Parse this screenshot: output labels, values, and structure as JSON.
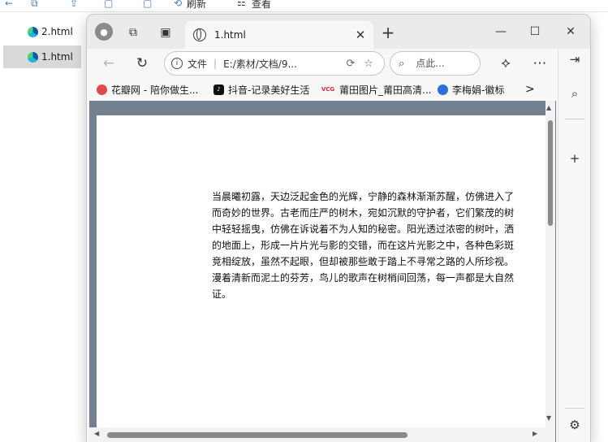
{
  "explorer": {
    "ribbon_items": [
      "刷新",
      "查看"
    ],
    "files": [
      {
        "name": "2.html",
        "selected": false
      },
      {
        "name": "1.html",
        "selected": true
      }
    ]
  },
  "browser": {
    "tab": {
      "title": "1.html"
    },
    "address": {
      "label": "文件",
      "url": "E:/素材/文档/9..."
    },
    "search": {
      "placeholder": "点此..."
    },
    "favorites": [
      {
        "label": "花瓣网 - 陪你做生...",
        "icon": "huaban-icon",
        "color": "#e24a4a"
      },
      {
        "label": "抖音-记录美好生活",
        "icon": "douyin-icon",
        "color": "#111111"
      },
      {
        "label": "莆田图片_莆田高清...",
        "icon": "vcg-icon",
        "color": "#e0243a",
        "badge": "VCG"
      },
      {
        "label": "李梅娟-徽标",
        "icon": "edge-icon",
        "color": "#2a6fdb"
      }
    ],
    "favorites_more": ">",
    "content": {
      "lines": [
        "当晨曦初露，天边泛起金色的光辉，宁静的森林渐渐苏醒，仿佛进入了",
        "而奇妙的世界。古老而庄严的树木，宛如沉默的守护者，它们繁茂的树",
        "中轻轻摇曳，仿佛在诉说着不为人知的秘密。阳光透过浓密的树叶，洒",
        "的地面上，形成一片片光与影的交错，而在这片光影之中，各种色彩斑",
        "竞相绽放，虽然不起眼，但却被那些敢于踏上不寻常之路的人所珍视。",
        "漫着清新而泥土的芬芳，鸟儿的歌声在树梢间回荡，每一声都是大自然",
        "证。"
      ]
    }
  }
}
